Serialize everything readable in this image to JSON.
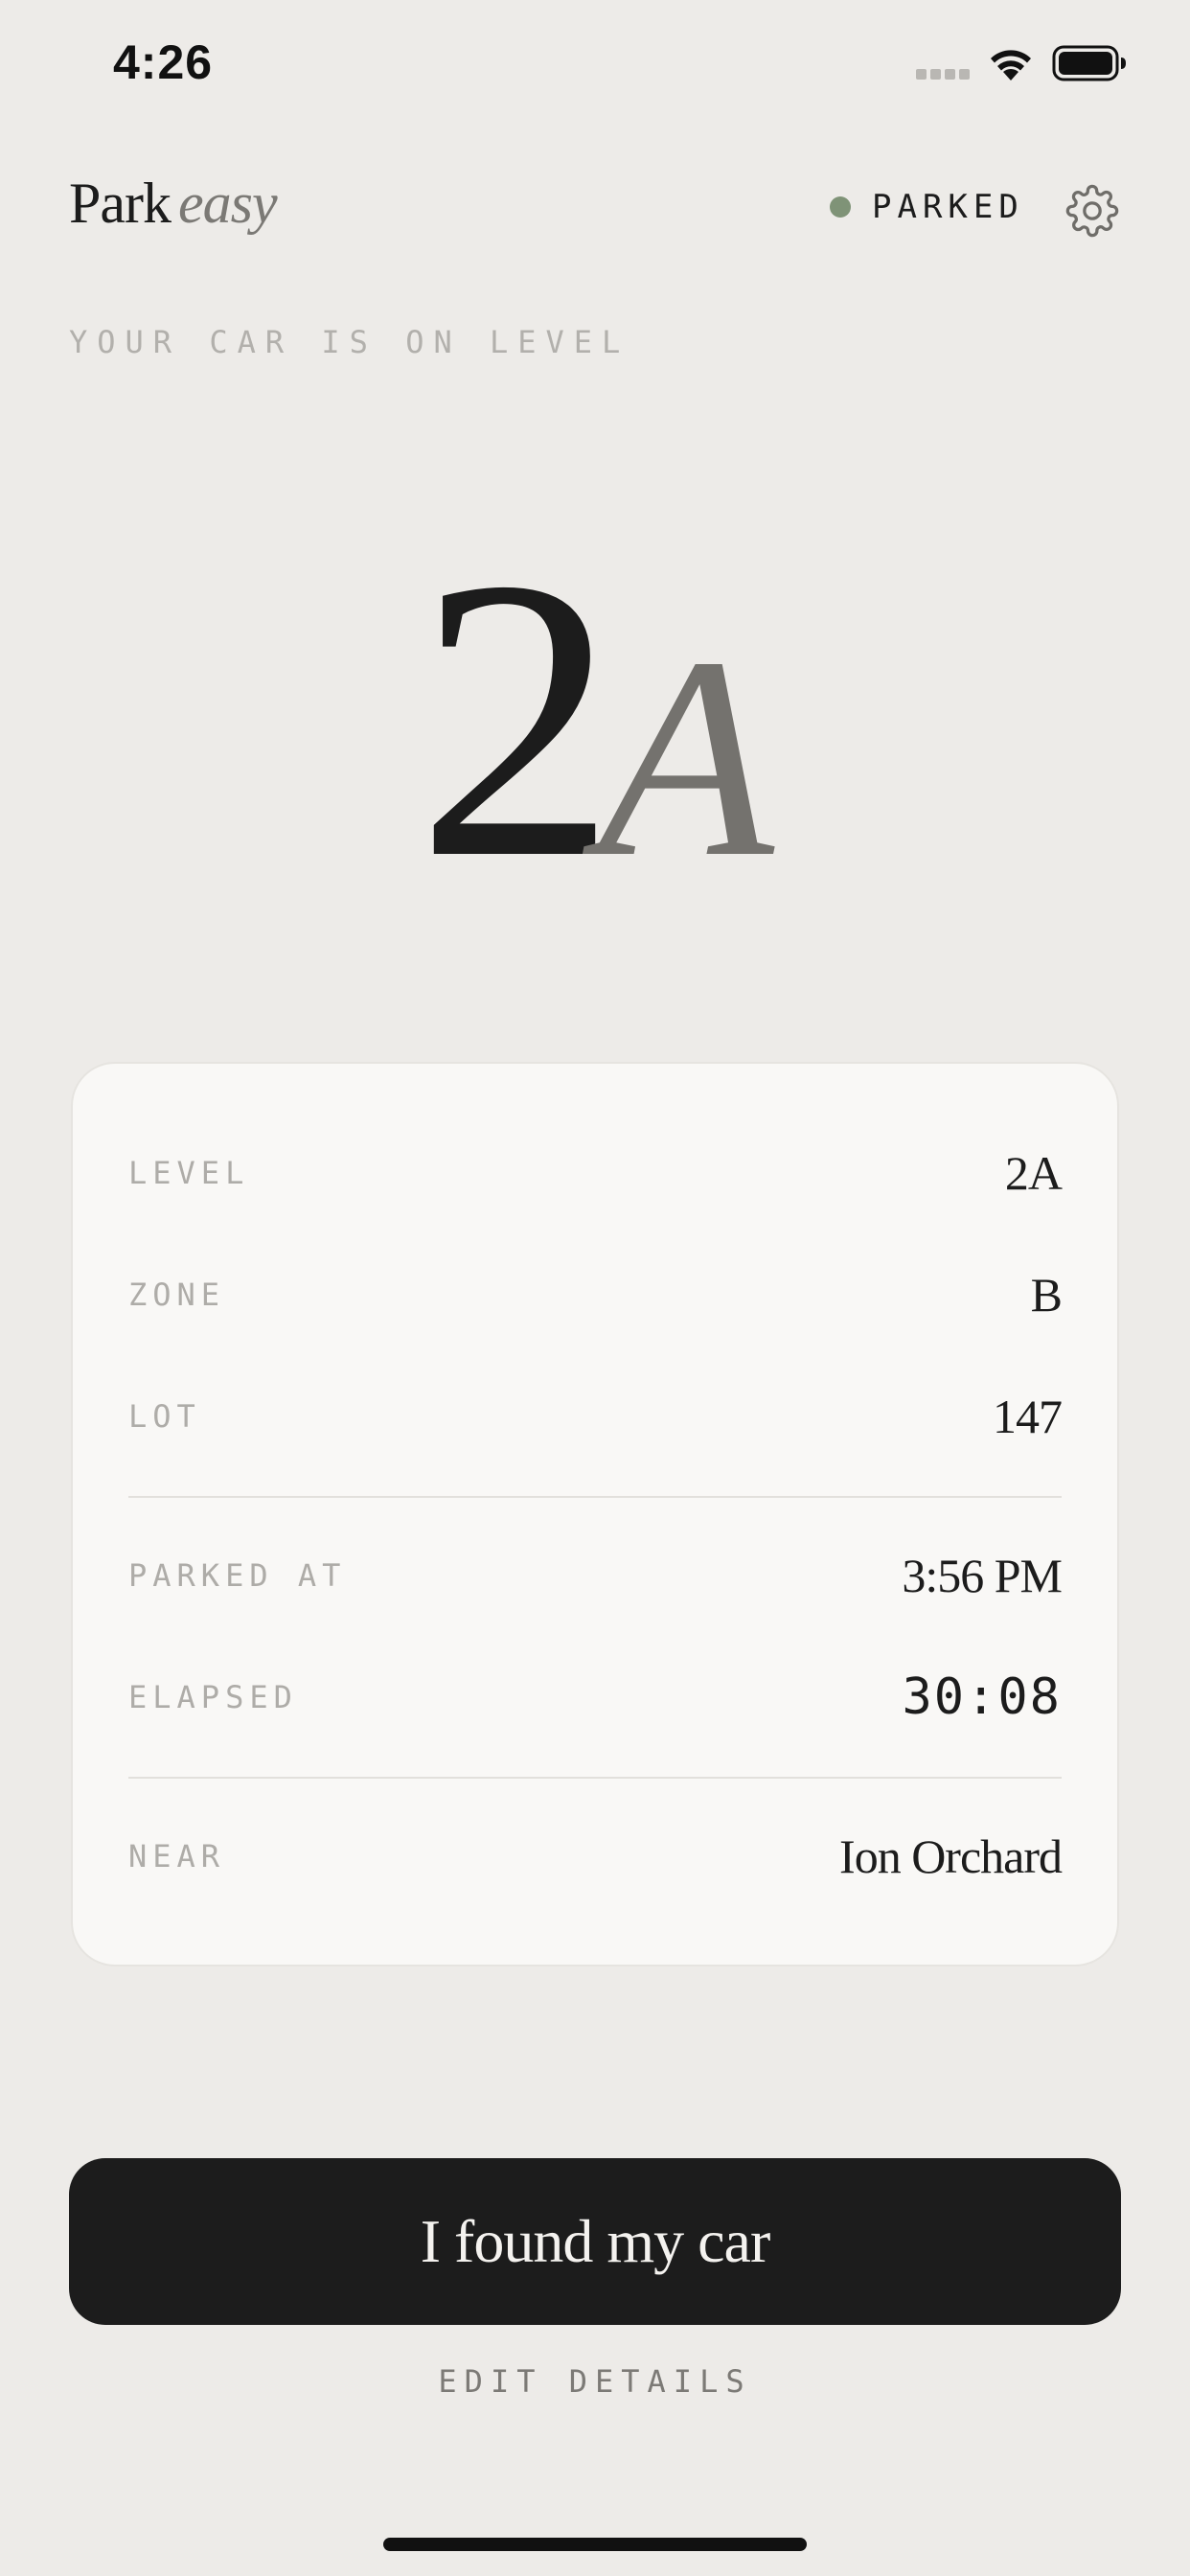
{
  "status_bar": {
    "time": "4:26"
  },
  "header": {
    "brand_main": "Park",
    "brand_accent": "easy",
    "status_label": "PARKED",
    "status_color": "#7f9377"
  },
  "hero": {
    "kicker": "YOUR CAR IS ON LEVEL",
    "level_number": "2",
    "level_suffix": "A"
  },
  "details": {
    "rows": [
      {
        "label": "LEVEL",
        "value": "2A"
      },
      {
        "label": "ZONE",
        "value": "B"
      },
      {
        "label": "LOT",
        "value": "147"
      },
      {
        "label": "PARKED AT",
        "value": "3:56 PM"
      },
      {
        "label": "ELAPSED",
        "value": "30:08"
      },
      {
        "label": "NEAR",
        "value": "Ion Orchard"
      }
    ]
  },
  "actions": {
    "primary_label": "I found my car",
    "secondary_label": "EDIT DETAILS"
  },
  "colors": {
    "background": "#edebe8",
    "card": "#f9f8f6",
    "ink": "#1c1c1c",
    "muted": "#aeaca8"
  }
}
